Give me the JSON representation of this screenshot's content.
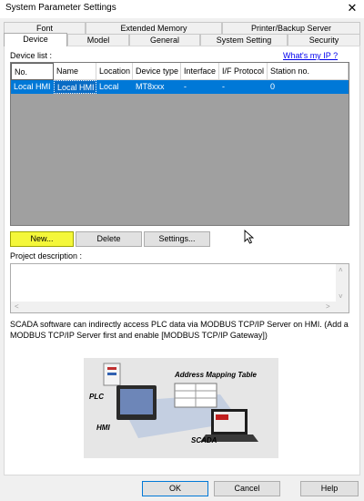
{
  "window": {
    "title": "System Parameter Settings",
    "close_glyph": "✕"
  },
  "tabs": {
    "row_back": [
      "Font",
      "Extended Memory",
      "Printer/Backup Server"
    ],
    "row_front": [
      "Device",
      "Model",
      "General",
      "System Setting",
      "Security"
    ],
    "active": "Device"
  },
  "device_list": {
    "label": "Device list :",
    "whats_my_ip": "What's my IP ?",
    "columns": [
      "No.",
      "Name",
      "Location",
      "Device type",
      "Interface",
      "I/F Protocol",
      "Station no."
    ],
    "rows": [
      [
        "Local HMI",
        "Local HMI",
        "Local",
        "MT8xxx",
        "-",
        "-",
        "0"
      ]
    ],
    "selected_row": 0
  },
  "buttons": {
    "new": "New...",
    "delete": "Delete",
    "settings": "Settings..."
  },
  "project_description": {
    "label": "Project description :",
    "value": ""
  },
  "scada_note": "SCADA software can indirectly access PLC data via MODBUS TCP/IP Server on HMI. (Add a MODBUS TCP/IP Server first and enable [MODBUS TCP/IP Gateway])",
  "diagram": {
    "labels": {
      "plc": "PLC",
      "hmi": "HMI",
      "scada": "SCADA",
      "mapping": "Address Mapping Table"
    }
  },
  "footer": {
    "ok": "OK",
    "cancel": "Cancel",
    "help": "Help"
  },
  "colors": {
    "selection": "#0078d7",
    "highlight": "#f4f73a",
    "list_bg": "#a0a0a0"
  }
}
